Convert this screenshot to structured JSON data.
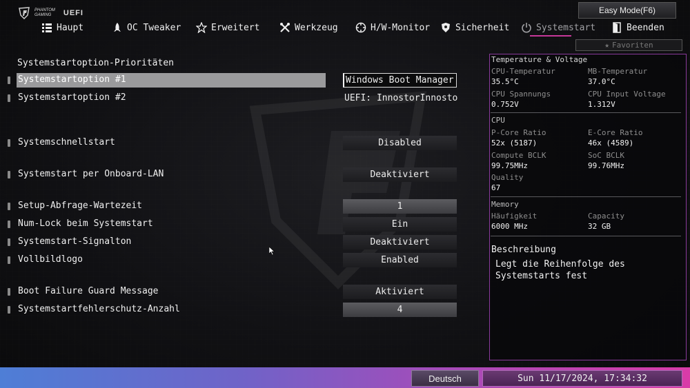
{
  "header": {
    "brand_line1": "PHANTOM",
    "brand_line2": "GAMING",
    "uefi": "UEFI",
    "easy_mode": "Easy Mode(F6)",
    "favorites": "Favoriten"
  },
  "tabs": [
    {
      "label": "Haupt",
      "icon": "list-icon"
    },
    {
      "label": "OC Tweaker",
      "icon": "rocket-icon"
    },
    {
      "label": "Erweitert",
      "icon": "star-icon"
    },
    {
      "label": "Werkzeug",
      "icon": "tools-icon"
    },
    {
      "label": "H/W-Monitor",
      "icon": "monitor-icon"
    },
    {
      "label": "Sicherheit",
      "icon": "shield-icon"
    },
    {
      "label": "Systemstart",
      "icon": "power-icon"
    },
    {
      "label": "Beenden",
      "icon": "exit-icon"
    }
  ],
  "settings": {
    "section_title": "Systemstartoption-Prioritäten",
    "rows": [
      {
        "label": "Systemstartoption #1",
        "value": "Windows Boot Manager ..."
      },
      {
        "label": "Systemstartoption #2",
        "value": "UEFI: InnostorInnosto..."
      },
      {
        "label": "Systemschnellstart",
        "value": "Disabled"
      },
      {
        "label": "Systemstart per Onboard-LAN",
        "value": "Deaktiviert"
      },
      {
        "label": "Setup-Abfrage-Wartezeit",
        "value": "1"
      },
      {
        "label": "Num-Lock beim Systemstart",
        "value": "Ein"
      },
      {
        "label": "Systemstart-Signalton",
        "value": "Deaktiviert"
      },
      {
        "label": "Vollbildlogo",
        "value": "Enabled"
      },
      {
        "label": "Boot Failure Guard Message",
        "value": "Aktiviert"
      },
      {
        "label": "Systemstartfehlerschutz-Anzahl",
        "value": "4"
      }
    ]
  },
  "panel": {
    "tv_title": "Temperature & Voltage",
    "cpu_temp_label": "CPU-Temperatur",
    "cpu_temp": "35.5°C",
    "mb_temp_label": "MB-Temperatur",
    "mb_temp": "37.0°C",
    "cpu_volt_label": "CPU Spannungs",
    "cpu_volt": "0.752V",
    "cpu_input_label": "CPU Input Voltage",
    "cpu_input": "1.312V",
    "cpu_title": "CPU",
    "pcore_label": "P-Core Ratio",
    "pcore": "52x (5187)",
    "ecore_label": "E-Core Ratio",
    "ecore": "46x (4589)",
    "bclk_label": "Compute BCLK",
    "bclk": "99.75MHz",
    "soc_label": "SoC BCLK",
    "soc": "99.76MHz",
    "quality_label": "Quality",
    "quality": "67",
    "mem_title": "Memory",
    "freq_label": "Häufigkeit",
    "freq": "6000 MHz",
    "cap_label": "Capacity",
    "cap": "32 GB",
    "desc_title": "Beschreibung",
    "desc_text": "Legt die Reihenfolge des Systemstarts fest"
  },
  "footer": {
    "language": "Deutsch",
    "datetime": "Sun 11/17/2024, 17:34:32"
  },
  "colors": {
    "accent": "#c8389a",
    "panel_border": "#8a3a9c",
    "bar_start": "#4e7ed6",
    "bar_end": "#d93ba8"
  }
}
